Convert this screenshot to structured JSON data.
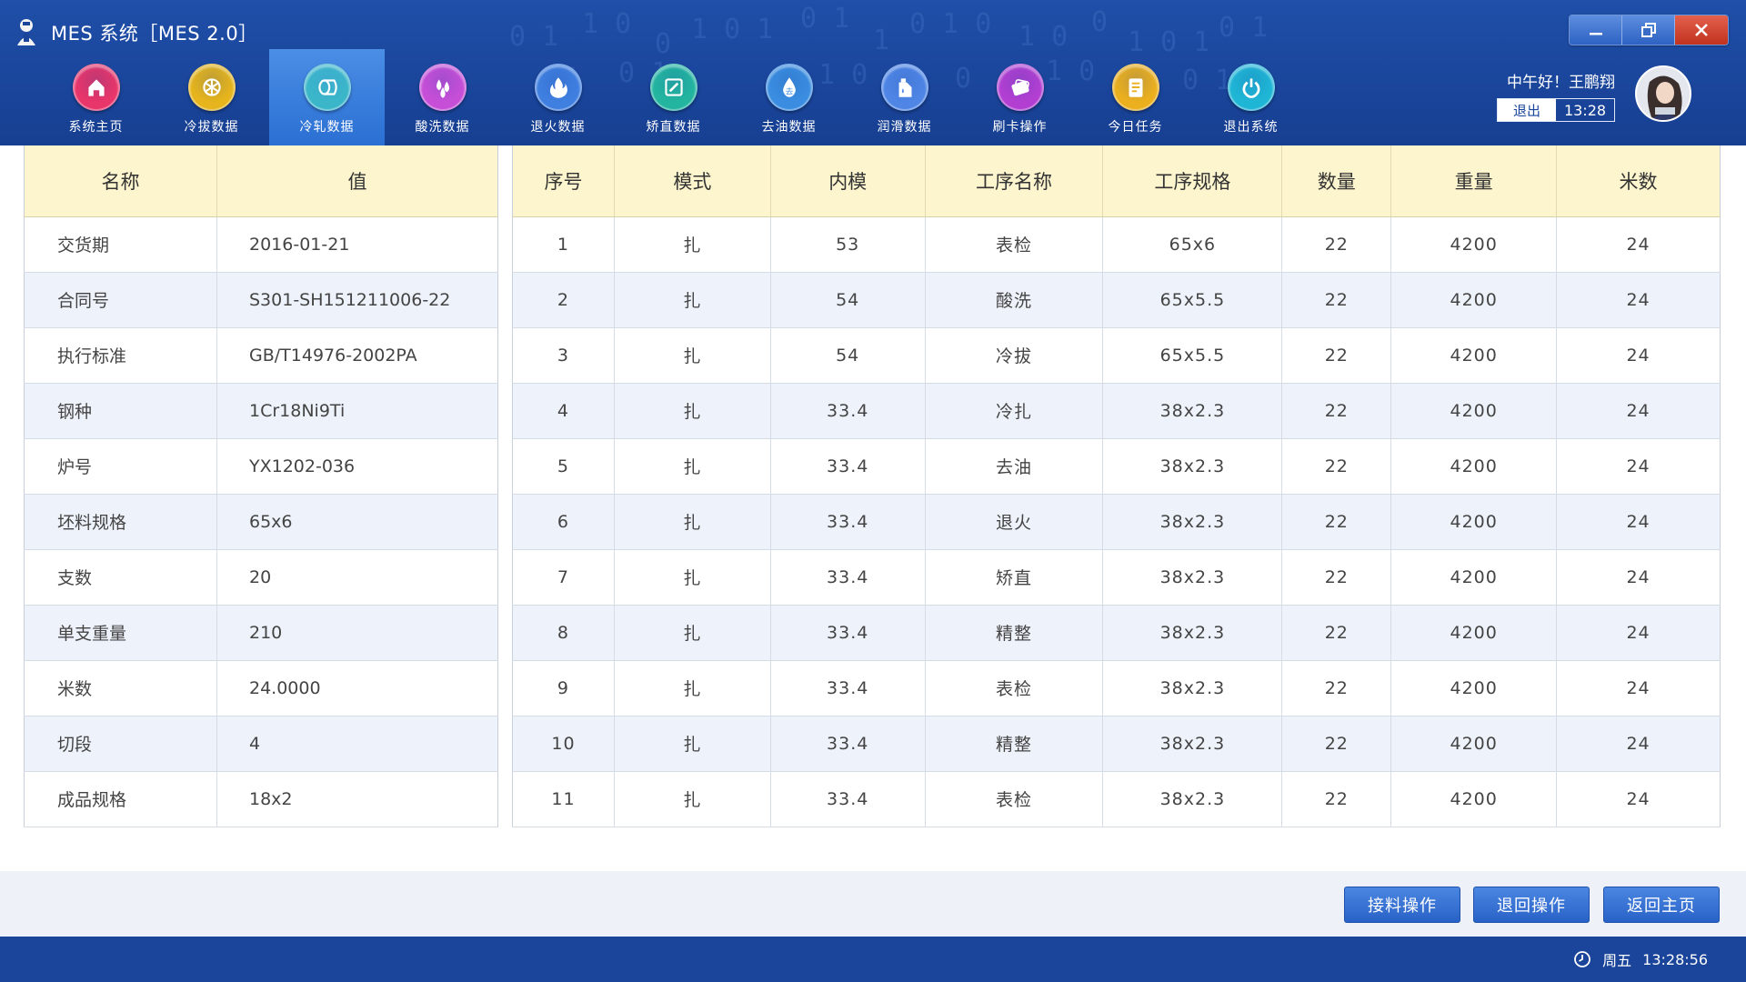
{
  "app": {
    "title": "MES 系统［MES 2.0］"
  },
  "nav": {
    "items": [
      {
        "label": "系统主页",
        "icon": "home-icon",
        "color": "#e8356a",
        "active": false
      },
      {
        "label": "冷拔数据",
        "icon": "snowflake-icon",
        "color": "#e6b41c",
        "active": false
      },
      {
        "label": "冷轧数据",
        "icon": "roll-icon",
        "color": "#3bb6c9",
        "active": true
      },
      {
        "label": "酸洗数据",
        "icon": "droplets-icon",
        "color": "#c74fd8",
        "active": false
      },
      {
        "label": "退火数据",
        "icon": "fire-icon",
        "color": "#3f7fe0",
        "active": false
      },
      {
        "label": "矫直数据",
        "icon": "straighten-icon",
        "color": "#23b5a0",
        "active": false
      },
      {
        "label": "去油数据",
        "icon": "degrease-icon",
        "color": "#3a8de0",
        "active": false
      },
      {
        "label": "润滑数据",
        "icon": "oil-can-icon",
        "color": "#4f86e6",
        "active": false
      },
      {
        "label": "刷卡操作",
        "icon": "card-icon",
        "color": "#b23fd2",
        "active": false
      },
      {
        "label": "今日任务",
        "icon": "task-icon",
        "color": "#ecb01e",
        "active": false
      },
      {
        "label": "退出系统",
        "icon": "power-icon",
        "color": "#1fb6d6",
        "active": false
      }
    ]
  },
  "user": {
    "greeting": "中午好！王鹏翔",
    "logout_label": "退出",
    "time": "13:28"
  },
  "info_table": {
    "headers": [
      "名称",
      "值"
    ],
    "rows": [
      [
        "交货期",
        "2016-01-21"
      ],
      [
        "合同号",
        "S301-SH151211006-22"
      ],
      [
        "执行标准",
        "GB/T14976-2002PA"
      ],
      [
        "钢种",
        "1Cr18Ni9Ti"
      ],
      [
        "炉号",
        "YX1202-036"
      ],
      [
        "坯料规格",
        "65x6"
      ],
      [
        "支数",
        "20"
      ],
      [
        "单支重量",
        "210"
      ],
      [
        "米数",
        "24.0000"
      ],
      [
        "切段",
        "4"
      ],
      [
        "成品规格",
        "18x2"
      ]
    ]
  },
  "process_table": {
    "headers": [
      "序号",
      "模式",
      "内模",
      "工序名称",
      "工序规格",
      "数量",
      "重量",
      "米数"
    ],
    "rows": [
      [
        "1",
        "扎",
        "53",
        "表检",
        "65x6",
        "22",
        "4200",
        "24"
      ],
      [
        "2",
        "扎",
        "54",
        "酸洗",
        "65x5.5",
        "22",
        "4200",
        "24"
      ],
      [
        "3",
        "扎",
        "54",
        "冷拔",
        "65x5.5",
        "22",
        "4200",
        "24"
      ],
      [
        "4",
        "扎",
        "33.4",
        "冷扎",
        "38x2.3",
        "22",
        "4200",
        "24"
      ],
      [
        "5",
        "扎",
        "33.4",
        "去油",
        "38x2.3",
        "22",
        "4200",
        "24"
      ],
      [
        "6",
        "扎",
        "33.4",
        "退火",
        "38x2.3",
        "22",
        "4200",
        "24"
      ],
      [
        "7",
        "扎",
        "33.4",
        "矫直",
        "38x2.3",
        "22",
        "4200",
        "24"
      ],
      [
        "8",
        "扎",
        "33.4",
        "精整",
        "38x2.3",
        "22",
        "4200",
        "24"
      ],
      [
        "9",
        "扎",
        "33.4",
        "表检",
        "38x2.3",
        "22",
        "4200",
        "24"
      ],
      [
        "10",
        "扎",
        "33.4",
        "精整",
        "38x2.3",
        "22",
        "4200",
        "24"
      ],
      [
        "11",
        "扎",
        "33.4",
        "表检",
        "38x2.3",
        "22",
        "4200",
        "24"
      ]
    ]
  },
  "actions": {
    "receive_label": "接料操作",
    "return_label": "退回操作",
    "home_label": "返回主页"
  },
  "status_bar": {
    "day": "周五",
    "time": "13:28:56"
  }
}
